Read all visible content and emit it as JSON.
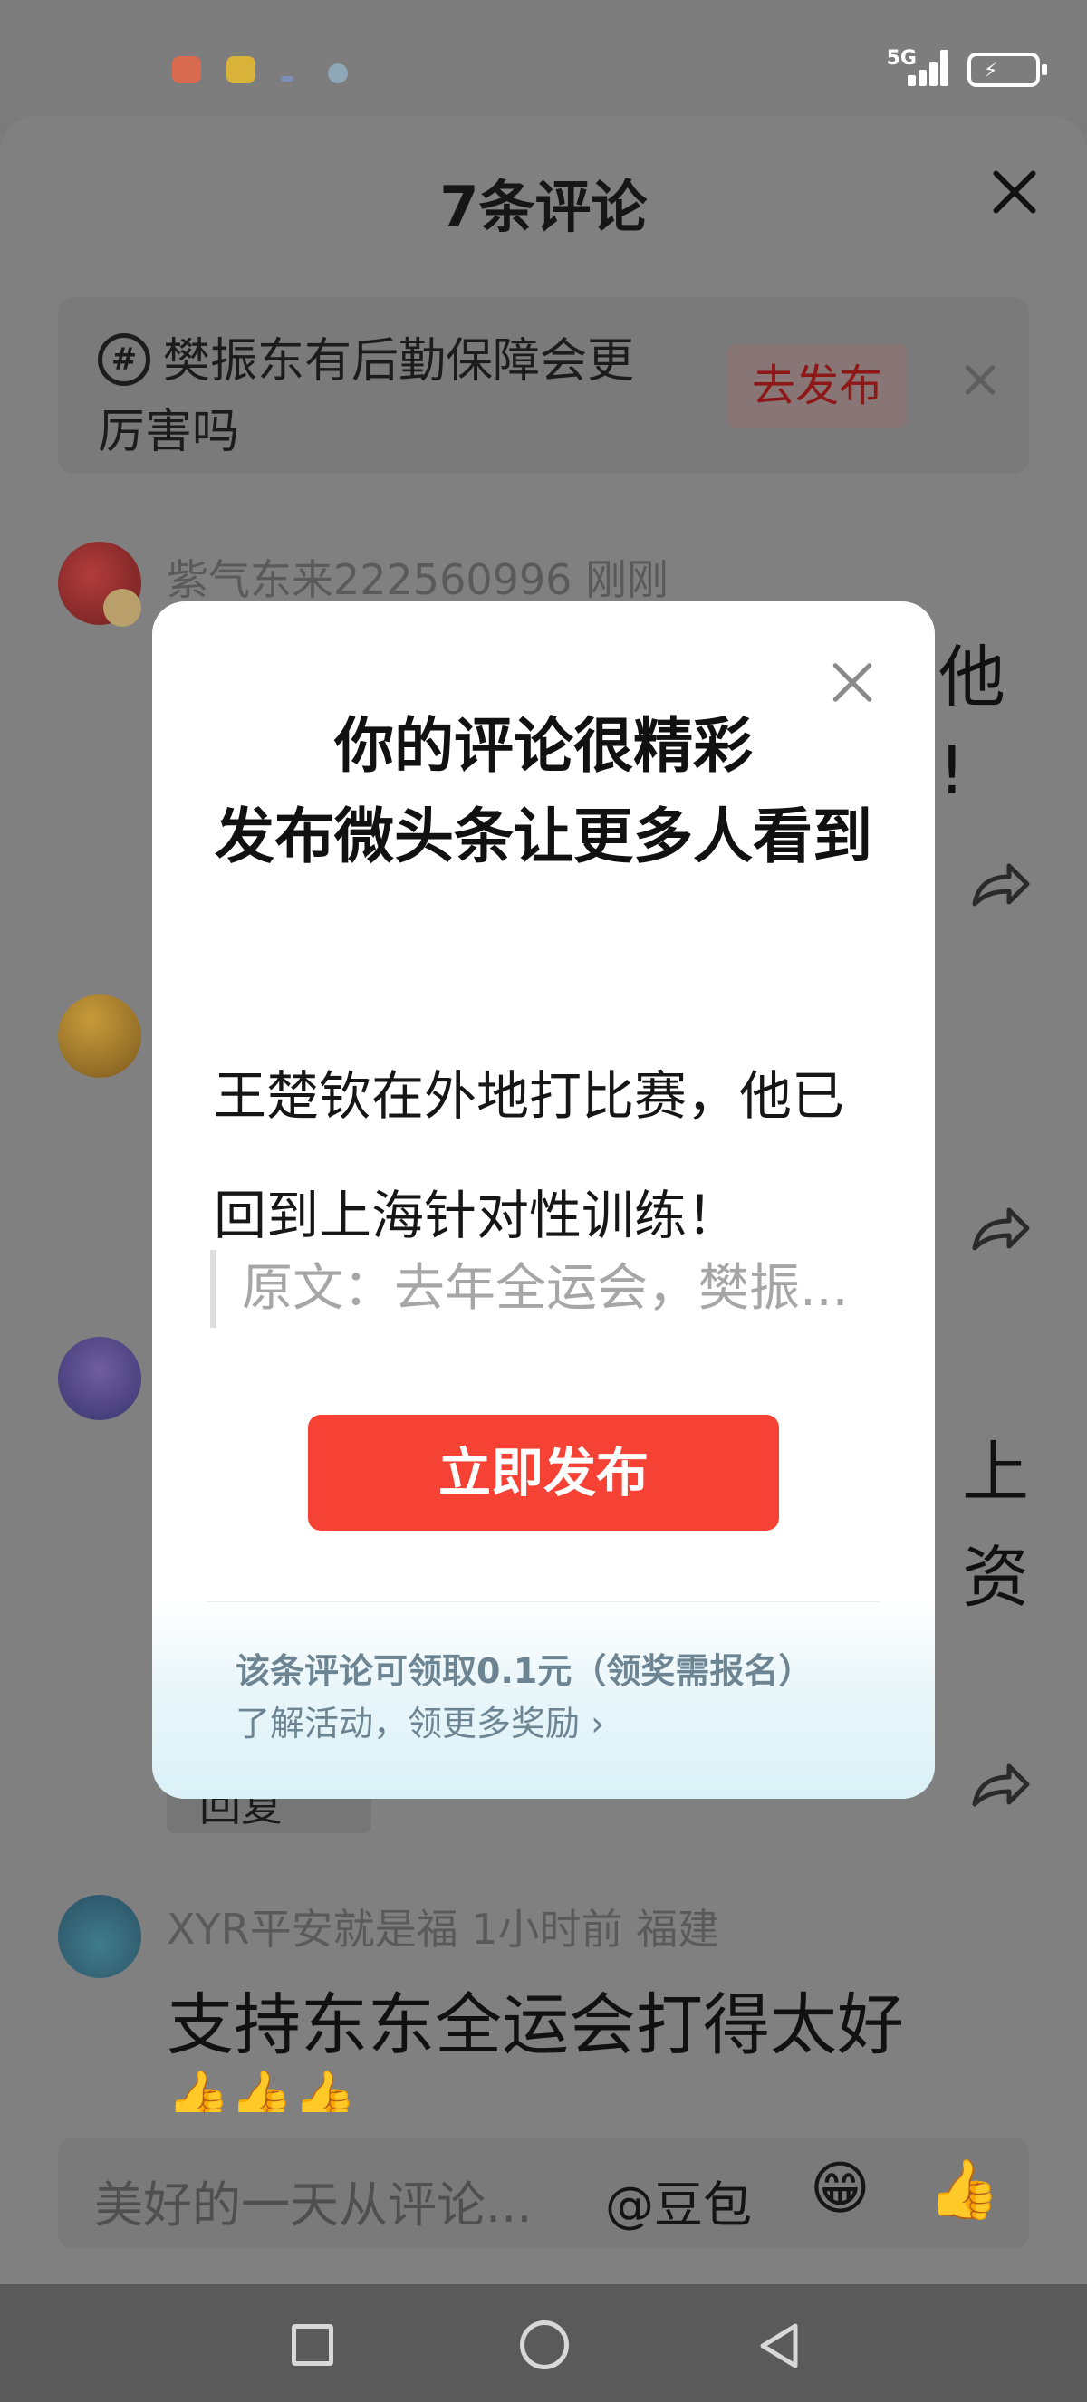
{
  "status_bar": {
    "network": "5G",
    "app_icon_colors": [
      "#d86a4f",
      "#d9b23a",
      "#7c8fb8",
      "#8fa8b8"
    ]
  },
  "sheet": {
    "title": "7条评论",
    "topic": {
      "text": "樊振东有后勤保障会更厉害吗",
      "publish_label": "去发布"
    },
    "comments": [
      {
        "meta": "紫气东来222560996  刚刚",
        "visible_right_fragments": [
          "他",
          "!"
        ]
      },
      {
        "meta": "",
        "visible_right_fragments": []
      },
      {
        "meta": "",
        "visible_right_fragments": [
          "上",
          "资"
        ],
        "reply_fragment": "回复"
      },
      {
        "meta": "XYR平安就是福  1小时前  福建",
        "text": "支持东东全运会打得太好",
        "emoji": "👍👍👍"
      }
    ],
    "input": {
      "placeholder": "美好的一天从评论...",
      "mention": "@豆包",
      "emoji_1": "😁",
      "emoji_2": "👍"
    }
  },
  "modal": {
    "title_line1": "你的评论很精彩",
    "title_line2": "发布微头条让更多人看到",
    "comment": "王楚钦在外地打比赛，他已回到上海针对性训练！",
    "quote": "原文：去年全运会，樊振...",
    "button_label": "立即发布",
    "footer_line1": "该条评论可领取0.1元（领奖需报名）",
    "footer_line2": "了解活动，领更多奖励 ›"
  }
}
